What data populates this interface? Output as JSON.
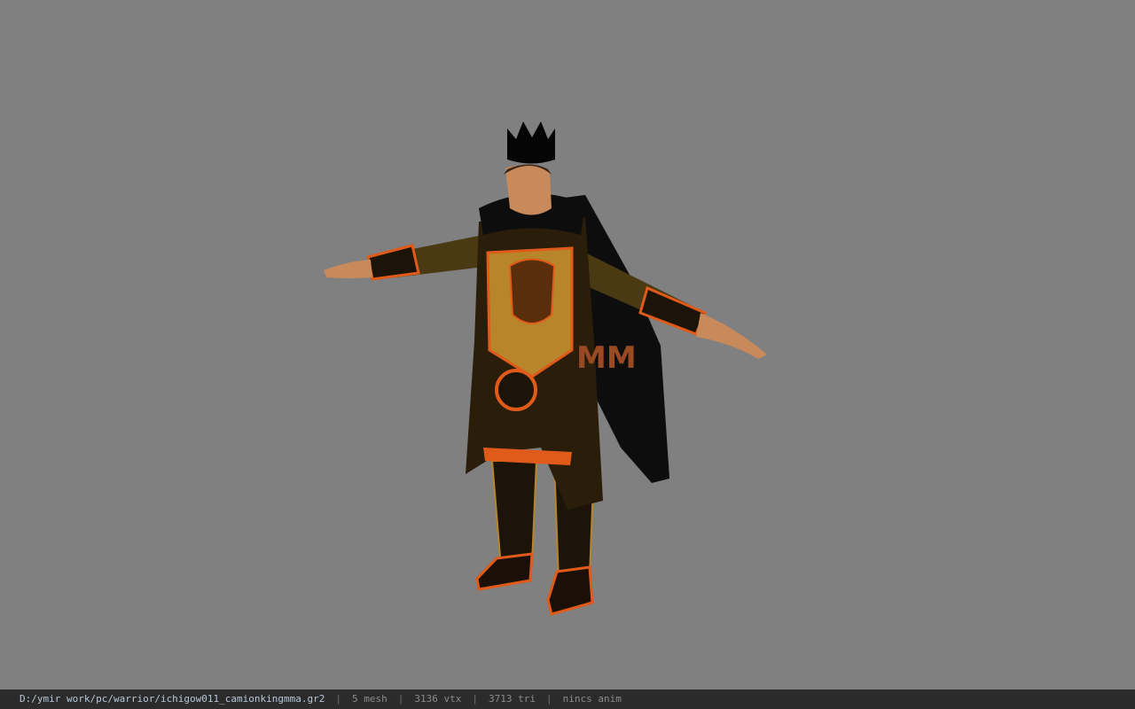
{
  "status": {
    "file_path": "D:/ymir work/pc/warrior/ichigow011_camionkingmma.gr2",
    "separator": "|",
    "mesh": "5 mesh",
    "vertices": "3136 vtx",
    "triangles": "3713 tri",
    "animation": "nincs anim"
  },
  "model": {
    "cape_lettering": "MM"
  },
  "colors": {
    "viewport_bg": "#808080",
    "statusbar_bg": "#2b2b2b",
    "path_text": "#b7c7d8",
    "stat_text": "#8c8c8c",
    "armor_gold": "#b8862a",
    "armor_orange": "#e05a1a",
    "cloak_black": "#0d0d0d",
    "skin": "#c88a5a"
  },
  "icons": {
    "crown": "crown-icon"
  }
}
